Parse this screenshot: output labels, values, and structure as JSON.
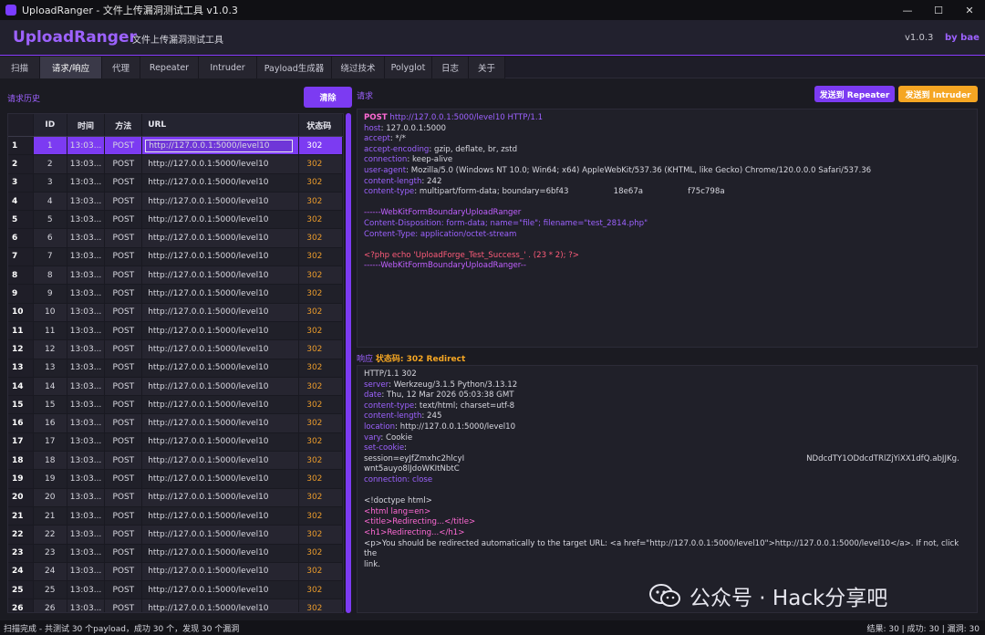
{
  "window": {
    "title": "UploadRanger - 文件上传漏洞测试工具 v1.0.3",
    "min": "—",
    "max": "☐",
    "close": "✕"
  },
  "header": {
    "brand": "UploadRanger",
    "subtitle": "文件上传漏洞测试工具",
    "version": "v1.0.3",
    "by": "by bae"
  },
  "tabs": [
    "扫描",
    "请求/响应",
    "代理",
    "Repeater",
    "Intruder",
    "Payload生成器",
    "绕过技术",
    "Polyglot",
    "日志",
    "关于"
  ],
  "active_tab": 1,
  "history": {
    "label": "请求历史",
    "clear_label": "清除",
    "columns": [
      "",
      "ID",
      "时间",
      "方法",
      "URL",
      "状态码"
    ],
    "rows": [
      {
        "n": "1",
        "id": "1",
        "time": "13:03...",
        "method": "POST",
        "url": "http://127.0.0.1:5000/level10",
        "status": "302"
      },
      {
        "n": "2",
        "id": "2",
        "time": "13:03...",
        "method": "POST",
        "url": "http://127.0.0.1:5000/level10",
        "status": "302"
      },
      {
        "n": "3",
        "id": "3",
        "time": "13:03...",
        "method": "POST",
        "url": "http://127.0.0.1:5000/level10",
        "status": "302"
      },
      {
        "n": "4",
        "id": "4",
        "time": "13:03...",
        "method": "POST",
        "url": "http://127.0.0.1:5000/level10",
        "status": "302"
      },
      {
        "n": "5",
        "id": "5",
        "time": "13:03...",
        "method": "POST",
        "url": "http://127.0.0.1:5000/level10",
        "status": "302"
      },
      {
        "n": "6",
        "id": "6",
        "time": "13:03...",
        "method": "POST",
        "url": "http://127.0.0.1:5000/level10",
        "status": "302"
      },
      {
        "n": "7",
        "id": "7",
        "time": "13:03...",
        "method": "POST",
        "url": "http://127.0.0.1:5000/level10",
        "status": "302"
      },
      {
        "n": "8",
        "id": "8",
        "time": "13:03...",
        "method": "POST",
        "url": "http://127.0.0.1:5000/level10",
        "status": "302"
      },
      {
        "n": "9",
        "id": "9",
        "time": "13:03...",
        "method": "POST",
        "url": "http://127.0.0.1:5000/level10",
        "status": "302"
      },
      {
        "n": "10",
        "id": "10",
        "time": "13:03...",
        "method": "POST",
        "url": "http://127.0.0.1:5000/level10",
        "status": "302"
      },
      {
        "n": "11",
        "id": "11",
        "time": "13:03...",
        "method": "POST",
        "url": "http://127.0.0.1:5000/level10",
        "status": "302"
      },
      {
        "n": "12",
        "id": "12",
        "time": "13:03...",
        "method": "POST",
        "url": "http://127.0.0.1:5000/level10",
        "status": "302"
      },
      {
        "n": "13",
        "id": "13",
        "time": "13:03...",
        "method": "POST",
        "url": "http://127.0.0.1:5000/level10",
        "status": "302"
      },
      {
        "n": "14",
        "id": "14",
        "time": "13:03...",
        "method": "POST",
        "url": "http://127.0.0.1:5000/level10",
        "status": "302"
      },
      {
        "n": "15",
        "id": "15",
        "time": "13:03...",
        "method": "POST",
        "url": "http://127.0.0.1:5000/level10",
        "status": "302"
      },
      {
        "n": "16",
        "id": "16",
        "time": "13:03...",
        "method": "POST",
        "url": "http://127.0.0.1:5000/level10",
        "status": "302"
      },
      {
        "n": "17",
        "id": "17",
        "time": "13:03...",
        "method": "POST",
        "url": "http://127.0.0.1:5000/level10",
        "status": "302"
      },
      {
        "n": "18",
        "id": "18",
        "time": "13:03...",
        "method": "POST",
        "url": "http://127.0.0.1:5000/level10",
        "status": "302"
      },
      {
        "n": "19",
        "id": "19",
        "time": "13:03...",
        "method": "POST",
        "url": "http://127.0.0.1:5000/level10",
        "status": "302"
      },
      {
        "n": "20",
        "id": "20",
        "time": "13:03...",
        "method": "POST",
        "url": "http://127.0.0.1:5000/level10",
        "status": "302"
      },
      {
        "n": "21",
        "id": "21",
        "time": "13:03...",
        "method": "POST",
        "url": "http://127.0.0.1:5000/level10",
        "status": "302"
      },
      {
        "n": "22",
        "id": "22",
        "time": "13:03...",
        "method": "POST",
        "url": "http://127.0.0.1:5000/level10",
        "status": "302"
      },
      {
        "n": "23",
        "id": "23",
        "time": "13:03...",
        "method": "POST",
        "url": "http://127.0.0.1:5000/level10",
        "status": "302"
      },
      {
        "n": "24",
        "id": "24",
        "time": "13:03...",
        "method": "POST",
        "url": "http://127.0.0.1:5000/level10",
        "status": "302"
      },
      {
        "n": "25",
        "id": "25",
        "time": "13:03...",
        "method": "POST",
        "url": "http://127.0.0.1:5000/level10",
        "status": "302"
      },
      {
        "n": "26",
        "id": "26",
        "time": "13:03...",
        "method": "POST",
        "url": "http://127.0.0.1:5000/level10",
        "status": "302"
      }
    ],
    "selected_row": 0
  },
  "request": {
    "label": "请求",
    "send_repeater": "发送到 Repeater",
    "send_intruder": "发送到 Intruder",
    "line_method": "POST",
    "line_url": "http://127.0.0.1:5000/level10",
    "line_proto": "HTTP/1.1",
    "headers": [
      [
        "host",
        "127.0.0.1:5000"
      ],
      [
        "accept",
        "*/*"
      ],
      [
        "accept-encoding",
        "gzip, deflate, br, zstd"
      ],
      [
        "connection",
        "keep-alive"
      ],
      [
        "user-agent",
        "Mozilla/5.0 (Windows NT 10.0; Win64; x64) AppleWebKit/537.36 (KHTML, like Gecko) Chrome/120.0.0.0 Safari/537.36"
      ],
      [
        "content-length",
        "242"
      ],
      [
        "content-type",
        "multipart/form-data; boundary=6bf43                  18e67a                  f75c798a"
      ]
    ],
    "boundary": "------WebKitFormBoundaryUploadRanger",
    "disposition": "Content-Disposition: form-data; name=\"file\"; filename=\"test_2814.php\"",
    "ctype": "Content-Type: application/octet-stream",
    "php": "<?php echo 'UploadForge_Test_Success_' . (23 * 2); ?>",
    "boundary_end": "------WebKitFormBoundaryUploadRanger--"
  },
  "response": {
    "label": "响应",
    "status_label": "状态码: 302 Redirect",
    "status_line": "HTTP/1.1 302",
    "headers": [
      [
        "server",
        "Werkzeug/3.1.5 Python/3.13.12"
      ],
      [
        "date",
        "Thu, 12 Mar 2026 05:03:38 GMT"
      ],
      [
        "content-type",
        "text/html; charset=utf-8"
      ],
      [
        "content-length",
        "245"
      ],
      [
        "location",
        "http://127.0.0.1:5000/level10"
      ],
      [
        "vary",
        "Cookie"
      ],
      [
        "set-cookie",
        ""
      ]
    ],
    "session_line": "session=eyJfZmxhc2hlcyI",
    "session_tail": "NDdcdTY1ODdcdTRlZjYiXX1dfQ.abJJKg.",
    "session_line2": "wnt5auyo8lJdoWKItNbtC",
    "connection": "connection: close",
    "html": [
      "<!doctype html>",
      "<html lang=en>",
      "<title>Redirecting...</title>",
      "<h1>Redirecting...</h1>",
      "<p>You should be redirected automatically to the target URL: <a href=\"http://127.0.0.1:5000/level10\">http://127.0.0.1:5000/level10</a>. If not, click the",
      "link."
    ]
  },
  "watermark": "公众号 · Hack分享吧",
  "status": {
    "left": "扫描完成 - 共测试 30 个payload，成功 30 个，发现 30 个漏洞",
    "right": "结果: 30 | 成功: 30 | 漏洞: 30"
  }
}
